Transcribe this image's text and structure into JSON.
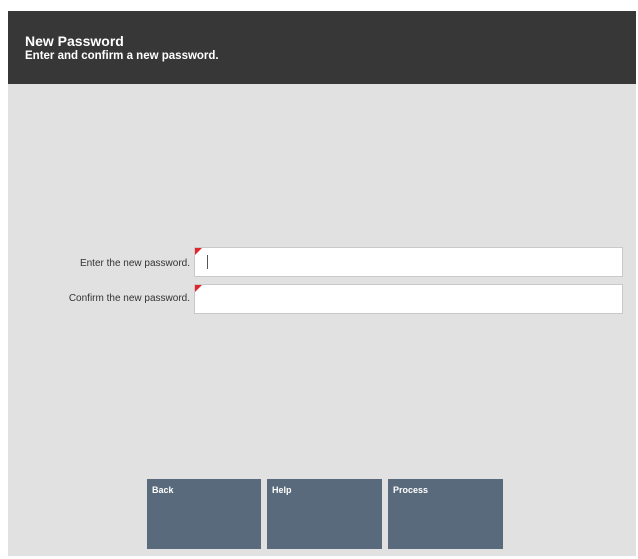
{
  "header": {
    "title": "New Password",
    "subtitle": "Enter and confirm a new password."
  },
  "form": {
    "fields": [
      {
        "label": "Enter the new password.",
        "value": ""
      },
      {
        "label": "Confirm the new password.",
        "value": ""
      }
    ]
  },
  "buttons": {
    "back": "Back",
    "help": "Help",
    "process": "Process"
  },
  "colors": {
    "header_bg": "#373737",
    "panel_bg": "#e1e1e1",
    "button_bg": "#596a7c",
    "required_marker": "#e0262c"
  }
}
